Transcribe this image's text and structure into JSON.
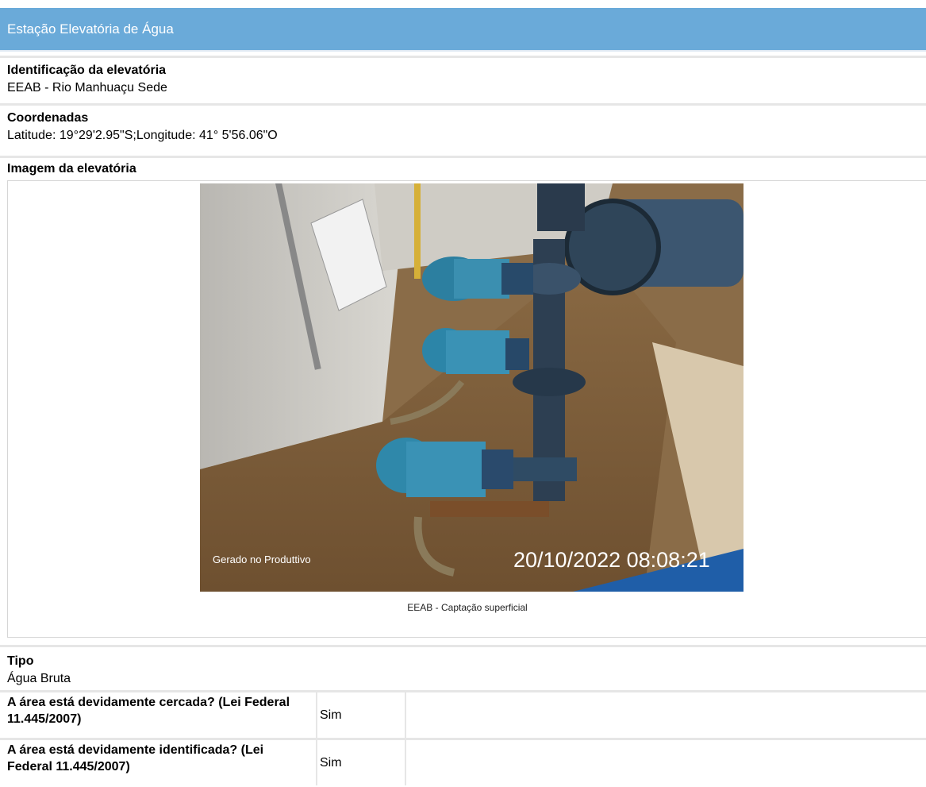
{
  "header": {
    "title": "Estação Elevatória de Água"
  },
  "identificacao": {
    "label": "Identificação da elevatória",
    "value": "EEAB - Rio Manhuaçu Sede"
  },
  "coordenadas": {
    "label": "Coordenadas",
    "value": "Latitude: 19°29'2.95\"S;Longitude: 41° 5'56.06\"O"
  },
  "imagem": {
    "label": "Imagem da elevatória",
    "watermark": "Gerado no Produttivo",
    "timestamp": "20/10/2022 08:08:21",
    "caption": "EEAB - Captação superficial"
  },
  "tipo": {
    "label": "Tipo",
    "value": "Água Bruta"
  },
  "perguntas": [
    {
      "question": "A área está devidamente cercada? (Lei Federal 11.445/2007)",
      "answer": "Sim"
    },
    {
      "question": "A área está devidamente identificada? (Lei Federal 11.445/2007)",
      "answer": "Sim"
    }
  ]
}
